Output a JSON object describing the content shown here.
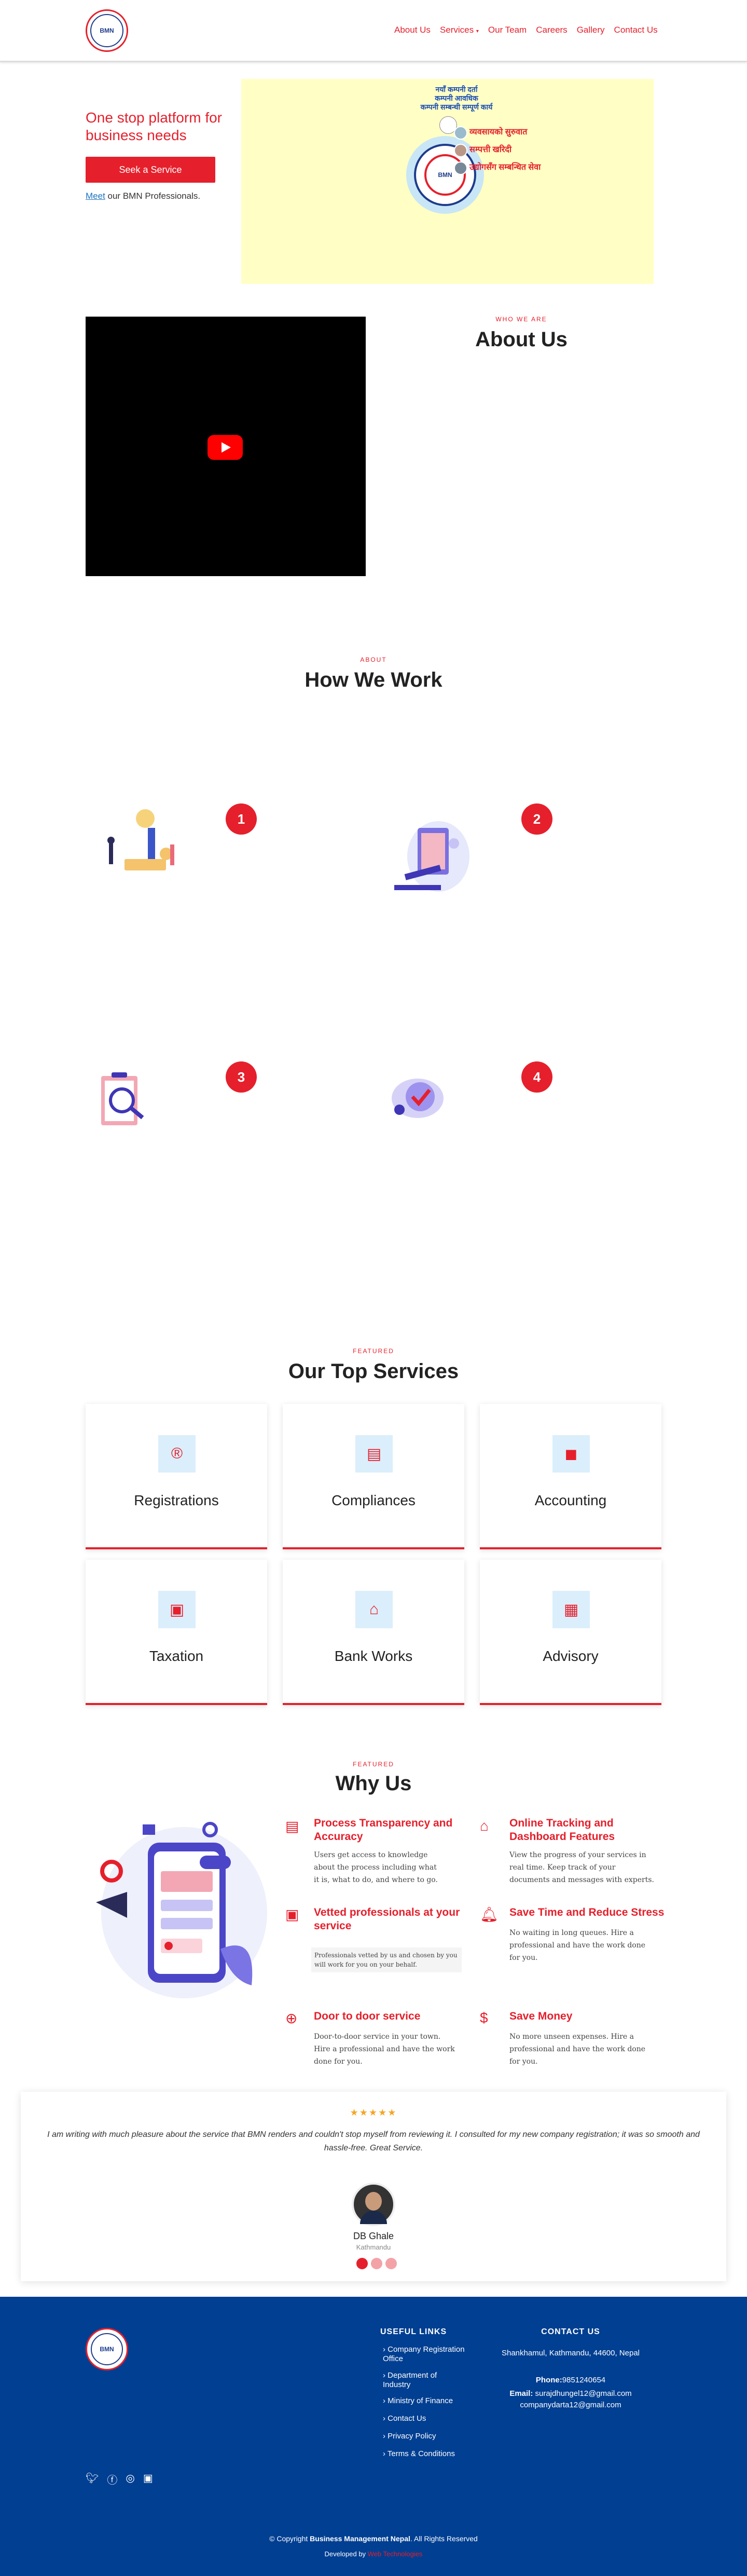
{
  "nav": {
    "items": [
      "About Us",
      "Services",
      "Our Team",
      "Careers",
      "Gallery",
      "Contact Us"
    ]
  },
  "hero": {
    "title": "One stop platform for business needs",
    "cta": "Seek a Service",
    "meet_link": "Meet",
    "meet_rest": " our BMN Professionals.",
    "banner_lines": [
      "नयाँ कम्पनी दर्ता",
      "कम्पनी आवधिक",
      "कम्पनी सम्बन्धी सम्पूर्ण कार्य"
    ],
    "banner_bullets": [
      "व्यवसायको सुरुवात",
      "सम्पत्ती खरिदी",
      "उद्योगसँग सम्बन्धित सेवा"
    ]
  },
  "about": {
    "kicker": "WHO WE ARE",
    "title": "About Us"
  },
  "how": {
    "kicker": "ABOUT",
    "title": "How We Work",
    "steps": [
      "1",
      "2",
      "3",
      "4"
    ]
  },
  "services": {
    "kicker": "FEATURED",
    "title": "Our Top Services",
    "cards": [
      {
        "title": "Registrations",
        "icon": "registered-icon"
      },
      {
        "title": "Compliances",
        "icon": "document-icon"
      },
      {
        "title": "Accounting",
        "icon": "account-icon"
      },
      {
        "title": "Taxation",
        "icon": "receipt-icon"
      },
      {
        "title": "Bank Works",
        "icon": "bank-icon"
      },
      {
        "title": "Advisory",
        "icon": "newspaper-icon"
      }
    ]
  },
  "why": {
    "kicker": "FEATURED",
    "title": "Why Us",
    "items": [
      {
        "title": "Process Transparency and Accuracy",
        "desc": "Users get access to knowledge about the process including what it is, what to do, and where to go.",
        "icon": "document-icon"
      },
      {
        "title": "Online Tracking and Dashboard Features",
        "desc": "View the progress of your services in real time. Keep track of your documents and messages with experts.",
        "icon": "home-icon"
      },
      {
        "title": "Vetted professionals at your service",
        "desc": "Professionals vetted by us and chosen by you will work for you on your behalf.",
        "icon": "person-card-icon"
      },
      {
        "title": "Save Time and Reduce Stress",
        "desc": "No waiting in long queues. Hire a professional and have the work done for you.",
        "icon": "bell-icon"
      },
      {
        "title": "Door to door service",
        "desc": "Door-to-door service in your town. Hire a professional and have the work done for you.",
        "icon": "location-icon"
      },
      {
        "title": "Save Money",
        "desc": "No more unseen expenses. Hire a professional and have the work done for you.",
        "icon": "money-icon"
      }
    ]
  },
  "testimonial": {
    "stars": "★★★★★",
    "quote": "I am writing with much pleasure about the service that BMN renders and couldn't stop myself from reviewing it. I consulted for my new company registration; it was so smooth and hassle-free. Great Service.",
    "name": "DB Ghale",
    "place": "Kathmandu"
  },
  "footer": {
    "useful_title": "USEFUL LINKS",
    "links": [
      "Company Registration Office",
      "Department of Industry",
      "Ministry of Finance",
      "Contact Us",
      "Privacy Policy",
      "Terms & Conditions"
    ],
    "contact_title": "CONTACT US",
    "address": "Shankhamul, Kathmandu, 44600, Nepal",
    "phone_label": "Phone:",
    "phone": "9851240654",
    "email_label": "Email:",
    "email1": "surajdhungel12@gmail.com",
    "email2": "companydarta12@gmail.com",
    "copyright_pre": "© Copyright ",
    "copyright_brand": "Business Management Nepal",
    "copyright_post": ". All Rights Reserved",
    "developed_by": "Developed by",
    "developer": "Web Technologies"
  }
}
